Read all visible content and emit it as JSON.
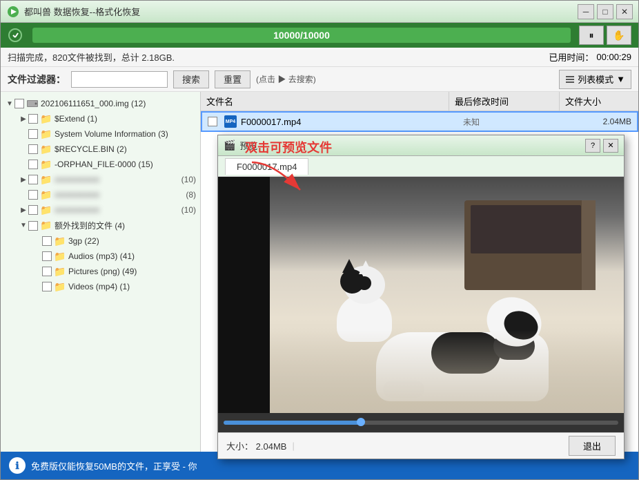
{
  "window": {
    "title": "都叫兽 数据恢复--格式化恢复",
    "minimize_label": "─",
    "maximize_label": "□",
    "close_label": "✕"
  },
  "progress": {
    "value": "10000/10000",
    "pause_btn": "⏸",
    "hand_btn": "✋"
  },
  "scan_info": {
    "text": "扫描完成，820文件被找到，总计 2.18GB."
  },
  "time_info": {
    "label": "已用时间：",
    "value": "00:00:29"
  },
  "toolbar": {
    "filter_label": "文件过滤器：",
    "search_btn": "搜索",
    "reset_btn": "重置",
    "hint": "(点击 ▶ 去搜索)",
    "view_mode": "列表模式"
  },
  "file_table": {
    "col_name": "文件名",
    "col_time": "最后修改时间",
    "col_size": "文件大小",
    "rows": [
      {
        "name": "F0000017.mp4",
        "time": "未知",
        "size": "2.04MB",
        "selected": true
      }
    ]
  },
  "tree": {
    "items": [
      {
        "label": "202106111651_000.img (12)",
        "indent": 0,
        "has_arrow": true,
        "checked": false,
        "type": "drive"
      },
      {
        "label": "$Extend (1)",
        "indent": 1,
        "has_arrow": true,
        "checked": false,
        "type": "folder"
      },
      {
        "label": "System Volume Information (3)",
        "indent": 1,
        "has_arrow": false,
        "checked": false,
        "type": "folder"
      },
      {
        "label": "$RECYCLE.BIN (2)",
        "indent": 1,
        "has_arrow": false,
        "checked": false,
        "type": "folder"
      },
      {
        "label": "-ORPHAN_FILE-0000 (15)",
        "indent": 1,
        "has_arrow": false,
        "checked": false,
        "type": "folder"
      },
      {
        "label": "(10)",
        "indent": 1,
        "has_arrow": true,
        "checked": false,
        "type": "folder",
        "blurred": true
      },
      {
        "label": "(8)",
        "indent": 1,
        "has_arrow": false,
        "checked": false,
        "type": "folder",
        "blurred": true
      },
      {
        "label": "(10)",
        "indent": 1,
        "has_arrow": true,
        "checked": false,
        "type": "folder",
        "blurred": true
      },
      {
        "label": "额外找到的文件 (4)",
        "indent": 1,
        "has_arrow": true,
        "checked": false,
        "type": "folder_green",
        "expanded": true
      },
      {
        "label": "3gp (22)",
        "indent": 2,
        "has_arrow": false,
        "checked": false,
        "type": "folder"
      },
      {
        "label": "Audios (mp3) (41)",
        "indent": 2,
        "has_arrow": false,
        "checked": false,
        "type": "folder"
      },
      {
        "label": "Pictures (png) (49)",
        "indent": 2,
        "has_arrow": false,
        "checked": false,
        "type": "folder"
      },
      {
        "label": "Videos (mp4) (1)",
        "indent": 2,
        "has_arrow": false,
        "checked": false,
        "type": "folder"
      }
    ]
  },
  "preview": {
    "title": "预览",
    "help_label": "?",
    "close_label": "✕",
    "file_name": "F0000017.mp4",
    "size_label": "大小：",
    "size_value": "2.04MB",
    "exit_btn": "退出"
  },
  "annotation": {
    "text": "双击可预览文件"
  },
  "status_bar": {
    "text": "免费版仅能恢复50MB的文件，正享受 - 你"
  }
}
